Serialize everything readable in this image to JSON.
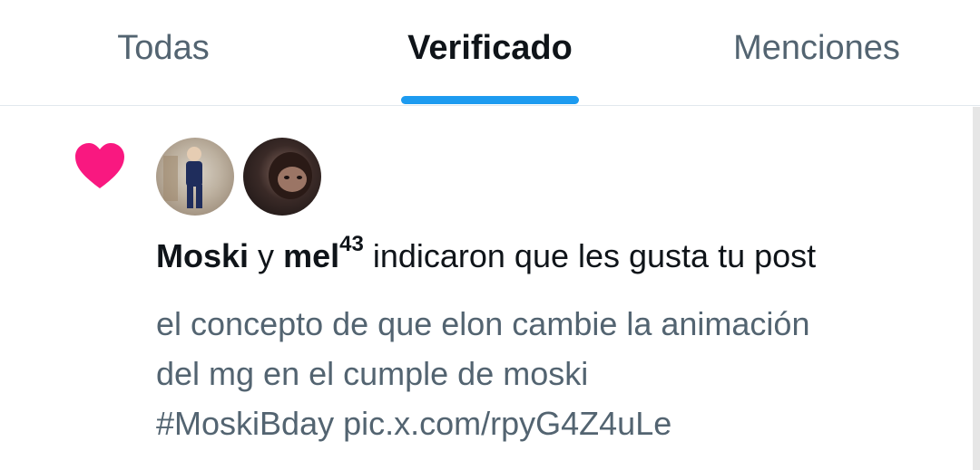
{
  "tabs": [
    {
      "label": "Todas",
      "active": false
    },
    {
      "label": "Verificado",
      "active": true
    },
    {
      "label": "Menciones",
      "active": false
    }
  ],
  "colors": {
    "accent": "#1d9bf0",
    "like": "#f91880",
    "text_primary": "#0f1419",
    "text_secondary": "#536471"
  },
  "notification": {
    "icon": "heart-icon",
    "user1": "Moski",
    "connector": "y",
    "user2": "mel",
    "user2_badge": "43",
    "action": "indicaron que les gusta tu post",
    "post_lines": [
      "el concepto de que elon cambie la animación",
      "del mg en el cumple de moski",
      "#MoskiBday pic.x.com/rpyG4Z4uLe"
    ]
  }
}
